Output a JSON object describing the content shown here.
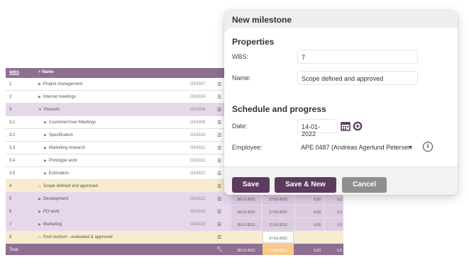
{
  "grid": {
    "headers": {
      "wbs": "WBS",
      "name": "Name",
      "add_symbol": "+"
    },
    "rows": [
      {
        "wbs": "1",
        "name": "Project management",
        "code": "O24307",
        "indent": 0,
        "arrow": "▶",
        "style": "normal"
      },
      {
        "wbs": "2",
        "name": "Internal meetings",
        "code": "O24324",
        "indent": 0,
        "arrow": "▶",
        "style": "normal"
      },
      {
        "wbs": "3",
        "name": "Prework",
        "code": "O24308",
        "indent": 0,
        "arrow": "▼",
        "style": "sel"
      },
      {
        "wbs": "3.1",
        "name": "Customer/User Meetings",
        "code": "O24309",
        "indent": 1,
        "arrow": "▶",
        "style": "normal"
      },
      {
        "wbs": "3.2",
        "name": "Specification",
        "code": "O24310",
        "indent": 1,
        "arrow": "▶",
        "style": "normal"
      },
      {
        "wbs": "3.3",
        "name": "Marketing research",
        "code": "O24321",
        "indent": 1,
        "arrow": "▶",
        "style": "normal"
      },
      {
        "wbs": "3.4",
        "name": "Prototype work",
        "code": "O24311",
        "indent": 1,
        "arrow": "▶",
        "style": "normal"
      },
      {
        "wbs": "3.5",
        "name": "Estimation",
        "code": "O24322",
        "indent": 1,
        "arrow": "▶",
        "style": "normal"
      },
      {
        "wbs": "4",
        "name": "Scope defined and approved",
        "code": "",
        "indent": 0,
        "arrow": "◇",
        "style": "ms"
      },
      {
        "wbs": "5",
        "name": "Development",
        "code": "O24312",
        "indent": 0,
        "arrow": "▶",
        "style": "sel",
        "start": "28-12-2021",
        "end": "27-03-2022",
        "v1": "0,00",
        "v2": "0,0"
      },
      {
        "wbs": "6",
        "name": "PO work",
        "code": "O24313",
        "indent": 0,
        "arrow": "▶",
        "style": "sel",
        "start": "28-12-2021",
        "end": "27-03-2022",
        "v1": "0,00",
        "v2": "0,0"
      },
      {
        "wbs": "7",
        "name": "Marketing",
        "code": "O24323",
        "indent": 0,
        "arrow": "▶",
        "style": "sel",
        "start": "28-12-2021",
        "end": "27-03-2022",
        "v1": "0,00",
        "v2": "0,0"
      },
      {
        "wbs": "8",
        "name": "Post mortum - evaluated & approved",
        "code": "",
        "indent": 0,
        "arrow": "◇",
        "style": "ms",
        "start": "",
        "end": "27-03-2022",
        "v1": "",
        "v2": ""
      }
    ],
    "total": {
      "label": "Total",
      "start": "28-12-2021",
      "end": "27-03-2022",
      "v1": "0,00",
      "v2": "0,0"
    }
  },
  "dialog": {
    "title": "New milestone",
    "properties_heading": "Properties",
    "wbs_label": "WBS:",
    "wbs_value": "7",
    "name_label": "Name:",
    "name_value": "Scope defined and approved",
    "schedule_heading": "Schedule and progress",
    "date_label": "Date:",
    "date_value": "14-01-2022",
    "employee_label": "Employee:",
    "employee_value": "APE 0487 (Andreas Agerlund Petersen",
    "info_symbol": "i",
    "buttons": {
      "save": "Save",
      "save_new": "Save & New",
      "cancel": "Cancel"
    }
  },
  "colors": {
    "header_purple": "#8e6f92",
    "button_purple": "#5c3b5f",
    "cancel_grey": "#8f8f8f",
    "milestone_row": "#f8ecd0",
    "highlight_orange": "#f7c98a"
  }
}
